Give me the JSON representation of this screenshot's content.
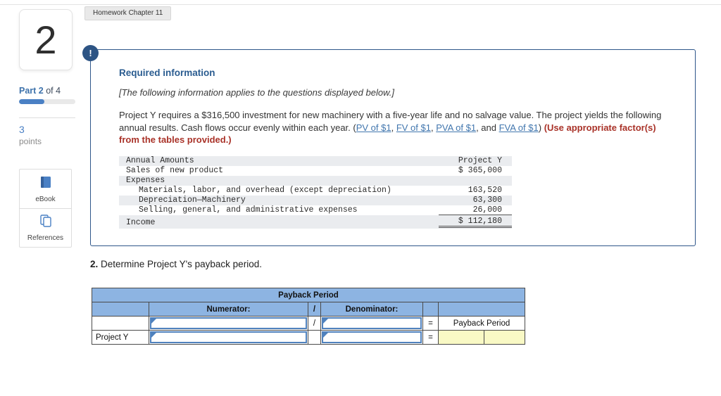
{
  "tab": {
    "label": "Homework Chapter 11"
  },
  "sidebar": {
    "question_number": "2",
    "part_bold": "Part 2",
    "part_rest": " of 4",
    "progress_fraction": 0.45,
    "points_value": "3",
    "points_label": "points",
    "ebook_label": "eBook",
    "references_label": "References"
  },
  "info_box": {
    "alert_glyph": "!",
    "heading": "Required information",
    "subheading": "[The following information applies to the questions displayed below.]",
    "paragraph": {
      "text_before": "Project Y requires a $316,500 investment for new machinery with a five-year life and no salvage value. The project yields the following annual results. Cash flows occur evenly within each year. (",
      "link_pv": "PV of $1",
      "sep1": ", ",
      "link_fv": "FV of $1",
      "sep2": ", ",
      "link_pva": "PVA of $1",
      "sep3": ", and ",
      "link_fva": "FVA of $1",
      "close_paren": ") ",
      "red_text": "(Use appropriate factor(s) from the tables provided.)"
    },
    "data_table": {
      "header": {
        "label": "Annual Amounts",
        "value": "Project Y"
      },
      "rows": [
        {
          "label": "Sales of new product",
          "value": "$ 365,000"
        },
        {
          "label": "Expenses",
          "value": ""
        },
        {
          "label": "Materials, labor, and overhead (except depreciation)",
          "value": "163,520"
        },
        {
          "label": "Depreciation—Machinery",
          "value": "63,300"
        },
        {
          "label": "Selling, general, and administrative expenses",
          "value": "26,000"
        },
        {
          "label": "Income",
          "value": "$ 112,180"
        }
      ]
    }
  },
  "question": {
    "number": "2.",
    "text": " Determine Project Y's payback period."
  },
  "payback_table": {
    "title": "Payback Period",
    "numerator_header": "Numerator:",
    "divide_sign": "/",
    "denominator_header": "Denominator:",
    "equals_sign": "=",
    "result_label": "Payback Period",
    "row_label": "Project Y",
    "numerator_value": "",
    "denominator_value": "",
    "result_value": "",
    "result_unit": ""
  },
  "colors": {
    "accent_blue": "#4a80c4",
    "info_border_blue": "#2e568a",
    "heading_blue": "#2a5c90",
    "link_blue": "#4176ae",
    "warning_red": "#a93228",
    "table_header_blue": "#8db4e2",
    "input_border_blue": "#4f81bd",
    "result_yellow": "#f9f9c5",
    "row_stripe_gray": "#eaecef"
  }
}
